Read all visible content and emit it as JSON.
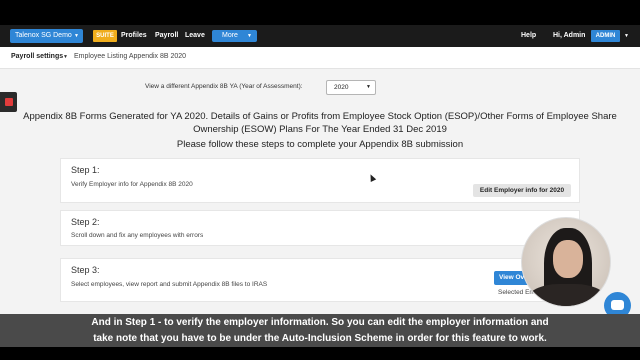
{
  "topnav": {
    "brand": "Talenox SG Demo",
    "suite": "SUITE",
    "links": [
      "Profiles",
      "Payroll",
      "Leave"
    ],
    "more": "More",
    "help": "Help",
    "greeting": "Hi, Admin",
    "admin_badge": "ADMIN"
  },
  "subnav": {
    "main": "Payroll settings",
    "sub": "Employee Listing Appendix 8B 2020"
  },
  "selector": {
    "label": "View a different Appendix 8B YA (Year of Assessment):",
    "value": "2020"
  },
  "heading": "Appendix 8B Forms Generated for YA 2020. Details of Gains or Profits from Employee Stock Option (ESOP)/Other Forms of Employee Share Ownership (ESOW) Plans For The Year Ended 31 Dec 2019",
  "instruction": "Please follow these steps to complete your Appendix 8B submission",
  "steps": [
    {
      "title": "Step 1:",
      "desc": "Verify Employer info for Appendix 8B 2020",
      "button": "Edit Employer info for 2020"
    },
    {
      "title": "Step 2:",
      "desc": "Scroll down and fix any employees with errors"
    },
    {
      "title": "Step 3:",
      "desc": "Select employees, view report and submit Appendix 8B files to IRAS",
      "button": "View Ov",
      "selected": "Selected Em"
    }
  ],
  "caption": {
    "line1": "And in Step 1 - to verify the employer information. So you can edit the employer information and",
    "line2": "take note that you have to be under the Auto-Inclusion Scheme in order for this feature to work."
  },
  "colors": {
    "accent": "#2f86d6",
    "suite": "#f0ad1c",
    "record": "#e23c3c"
  },
  "icons": [
    "caret-down-icon",
    "record-icon",
    "chat-icon",
    "cursor-icon"
  ]
}
